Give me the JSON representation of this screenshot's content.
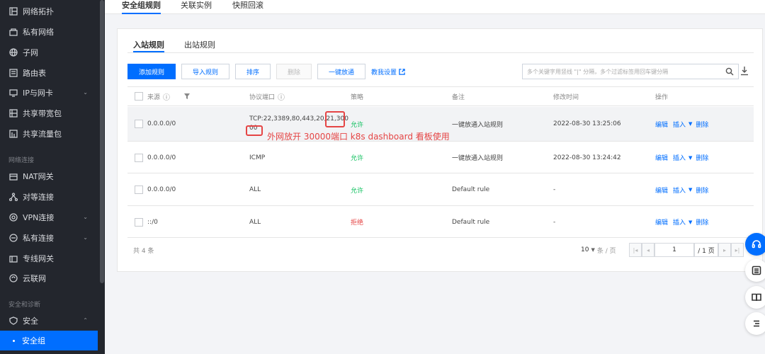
{
  "sidebar": {
    "items": [
      {
        "label": "网络拓扑",
        "icon": "topology-icon"
      },
      {
        "label": "私有网络",
        "icon": "vpc-icon"
      },
      {
        "label": "子网",
        "icon": "globe-icon"
      },
      {
        "label": "路由表",
        "icon": "route-table-icon"
      },
      {
        "label": "IP与网卡",
        "icon": "ip-nic-icon",
        "chevron": "⌄"
      },
      {
        "label": "共享带宽包",
        "icon": "bandwidth-icon"
      },
      {
        "label": "共享流量包",
        "icon": "traffic-icon"
      }
    ],
    "section_conn": "网络连接",
    "conn_items": [
      {
        "label": "NAT网关",
        "icon": "nat-gateway-icon"
      },
      {
        "label": "对等连接",
        "icon": "peering-icon"
      },
      {
        "label": "VPN连接",
        "icon": "vpn-icon",
        "chevron": "⌄"
      },
      {
        "label": "私有连接",
        "icon": "private-link-icon",
        "chevron": "⌄"
      },
      {
        "label": "专线网关",
        "icon": "dc-gateway-icon"
      },
      {
        "label": "云联网",
        "icon": "ccn-icon"
      }
    ],
    "section_sec": "安全和诊断",
    "security": {
      "label": "安全",
      "icon": "shield-icon",
      "chevron": "⌃"
    },
    "security_group": "安全组"
  },
  "top_tabs": [
    "安全组规则",
    "关联实例",
    "快照回滚"
  ],
  "sub_tabs": [
    "入站规则",
    "出站规则"
  ],
  "toolbar": {
    "add": "添加规则",
    "import": "导入规则",
    "sort": "排序",
    "delete": "删除",
    "one_click": "一键放通",
    "teach": "教我设置",
    "search_placeholder": "多个关键字用竖线 \"|\" 分隔，多个过滤标签用回车键分隔"
  },
  "table": {
    "headers": {
      "source": "来源",
      "port": "协议端口",
      "policy": "策略",
      "note": "备注",
      "time": "修改时间",
      "ops": "操作"
    },
    "rows": [
      {
        "source": "0.0.0.0/0",
        "port_line1": "TCP:22,3389,80,443,20,21,300",
        "port_line2": "00",
        "policy": "允许",
        "note": "一键放通入站规则",
        "time": "2022-08-30 13:25:06"
      },
      {
        "source": "0.0.0.0/0",
        "port": "ICMP",
        "policy": "允许",
        "note": "一键放通入站规则",
        "time": "2022-08-30 13:24:42"
      },
      {
        "source": "0.0.0.0/0",
        "port": "ALL",
        "policy": "允许",
        "note": "Default rule",
        "time": "-"
      },
      {
        "source": "::/0",
        "port": "ALL",
        "policy": "拒绝",
        "note": "Default rule",
        "time": "-"
      }
    ],
    "op_edit": "编辑",
    "op_insert": "插入",
    "op_delete": "删除"
  },
  "annotation": "外网放开 30000端口  k8s dashboard 看板使用",
  "footer": {
    "total": "共 4 条",
    "per_page": "10",
    "per_page_unit": "条 / 页",
    "page_input": "1",
    "page_total": "/ 1 页"
  },
  "colors": {
    "accent": "#006eff",
    "allow": "#0abf5b",
    "deny": "#e54545",
    "sidebar_bg": "#23262d"
  }
}
